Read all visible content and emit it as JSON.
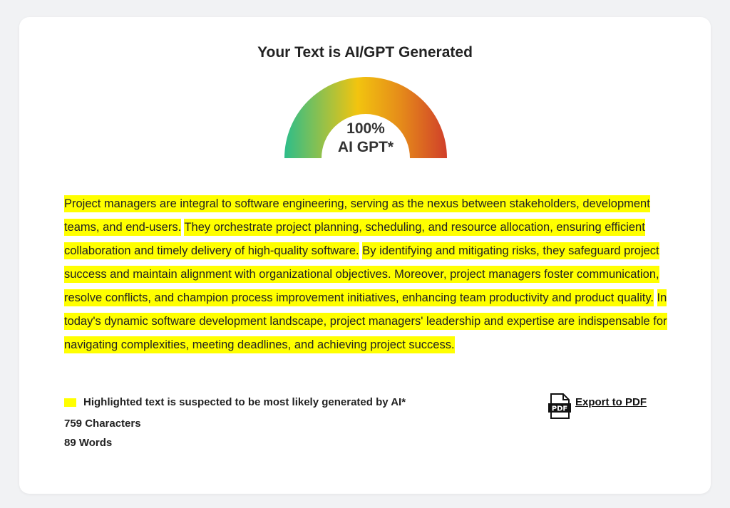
{
  "result": {
    "title": "Your Text is AI/GPT Generated",
    "gauge_percent": "100%",
    "gauge_label": "AI GPT*",
    "gauge_value": 1.0
  },
  "analyzed_text": {
    "sentences": [
      "Project managers are integral to software engineering, serving as the nexus between stakeholders, development teams, and end-users.",
      "They orchestrate project planning, scheduling, and resource allocation, ensuring efficient collaboration and timely delivery of high-quality software.",
      "By identifying and mitigating risks, they safeguard project success and maintain alignment with organizational objectives. Moreover, project managers foster communication, resolve conflicts, and champion process improvement initiatives, enhancing team productivity and product quality.",
      "In today's dynamic software development landscape, project managers' leadership and expertise are indispensable for navigating complexities, meeting deadlines, and achieving project success."
    ],
    "highlight_color": "#ffff00"
  },
  "legend": {
    "text": "Highlighted text is suspected to be most likely generated by AI*"
  },
  "stats": {
    "characters": "759 Characters",
    "words": "89 Words"
  },
  "export": {
    "label": "Export to PDF",
    "icon": "pdf-file-icon",
    "icon_text": "PDF"
  },
  "colors": {
    "gauge_start": "#2dbd8a",
    "gauge_mid": "#f2c40f",
    "gauge_end": "#d03f2a"
  }
}
